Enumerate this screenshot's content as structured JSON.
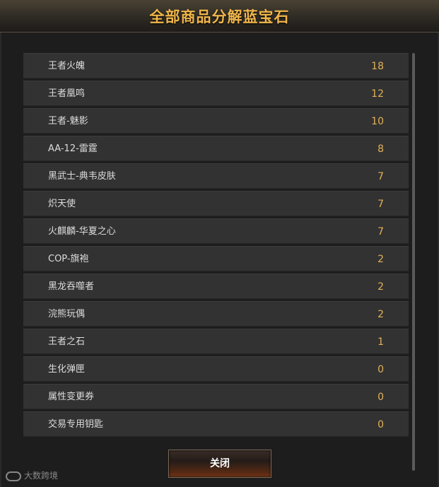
{
  "dialog": {
    "title": "全部商品分解蓝宝石",
    "close_label": "关闭"
  },
  "items": [
    {
      "name": "王者火魄",
      "count": "18"
    },
    {
      "name": "王者凰鸣",
      "count": "12"
    },
    {
      "name": "王者-魅影",
      "count": "10"
    },
    {
      "name": "AA-12-雷霆",
      "count": "8"
    },
    {
      "name": "黑武士-典韦皮肤",
      "count": "7"
    },
    {
      "name": "炽天使",
      "count": "7"
    },
    {
      "name": "火麒麟-华夏之心",
      "count": "7"
    },
    {
      "name": "COP-旗袍",
      "count": "2"
    },
    {
      "name": "黑龙吞噬者",
      "count": "2"
    },
    {
      "name": "浣熊玩偶",
      "count": "2"
    },
    {
      "name": "王者之石",
      "count": "1"
    },
    {
      "name": "生化弹匣",
      "count": "0"
    },
    {
      "name": "属性变更券",
      "count": "0"
    },
    {
      "name": "交易专用钥匙",
      "count": "0"
    }
  ],
  "watermark": {
    "text": "大数跨境",
    "icon": "brand-logo-icon"
  },
  "colors": {
    "title": "#f0b64a",
    "count": "#e2b15a",
    "row_bg": "#323232"
  }
}
